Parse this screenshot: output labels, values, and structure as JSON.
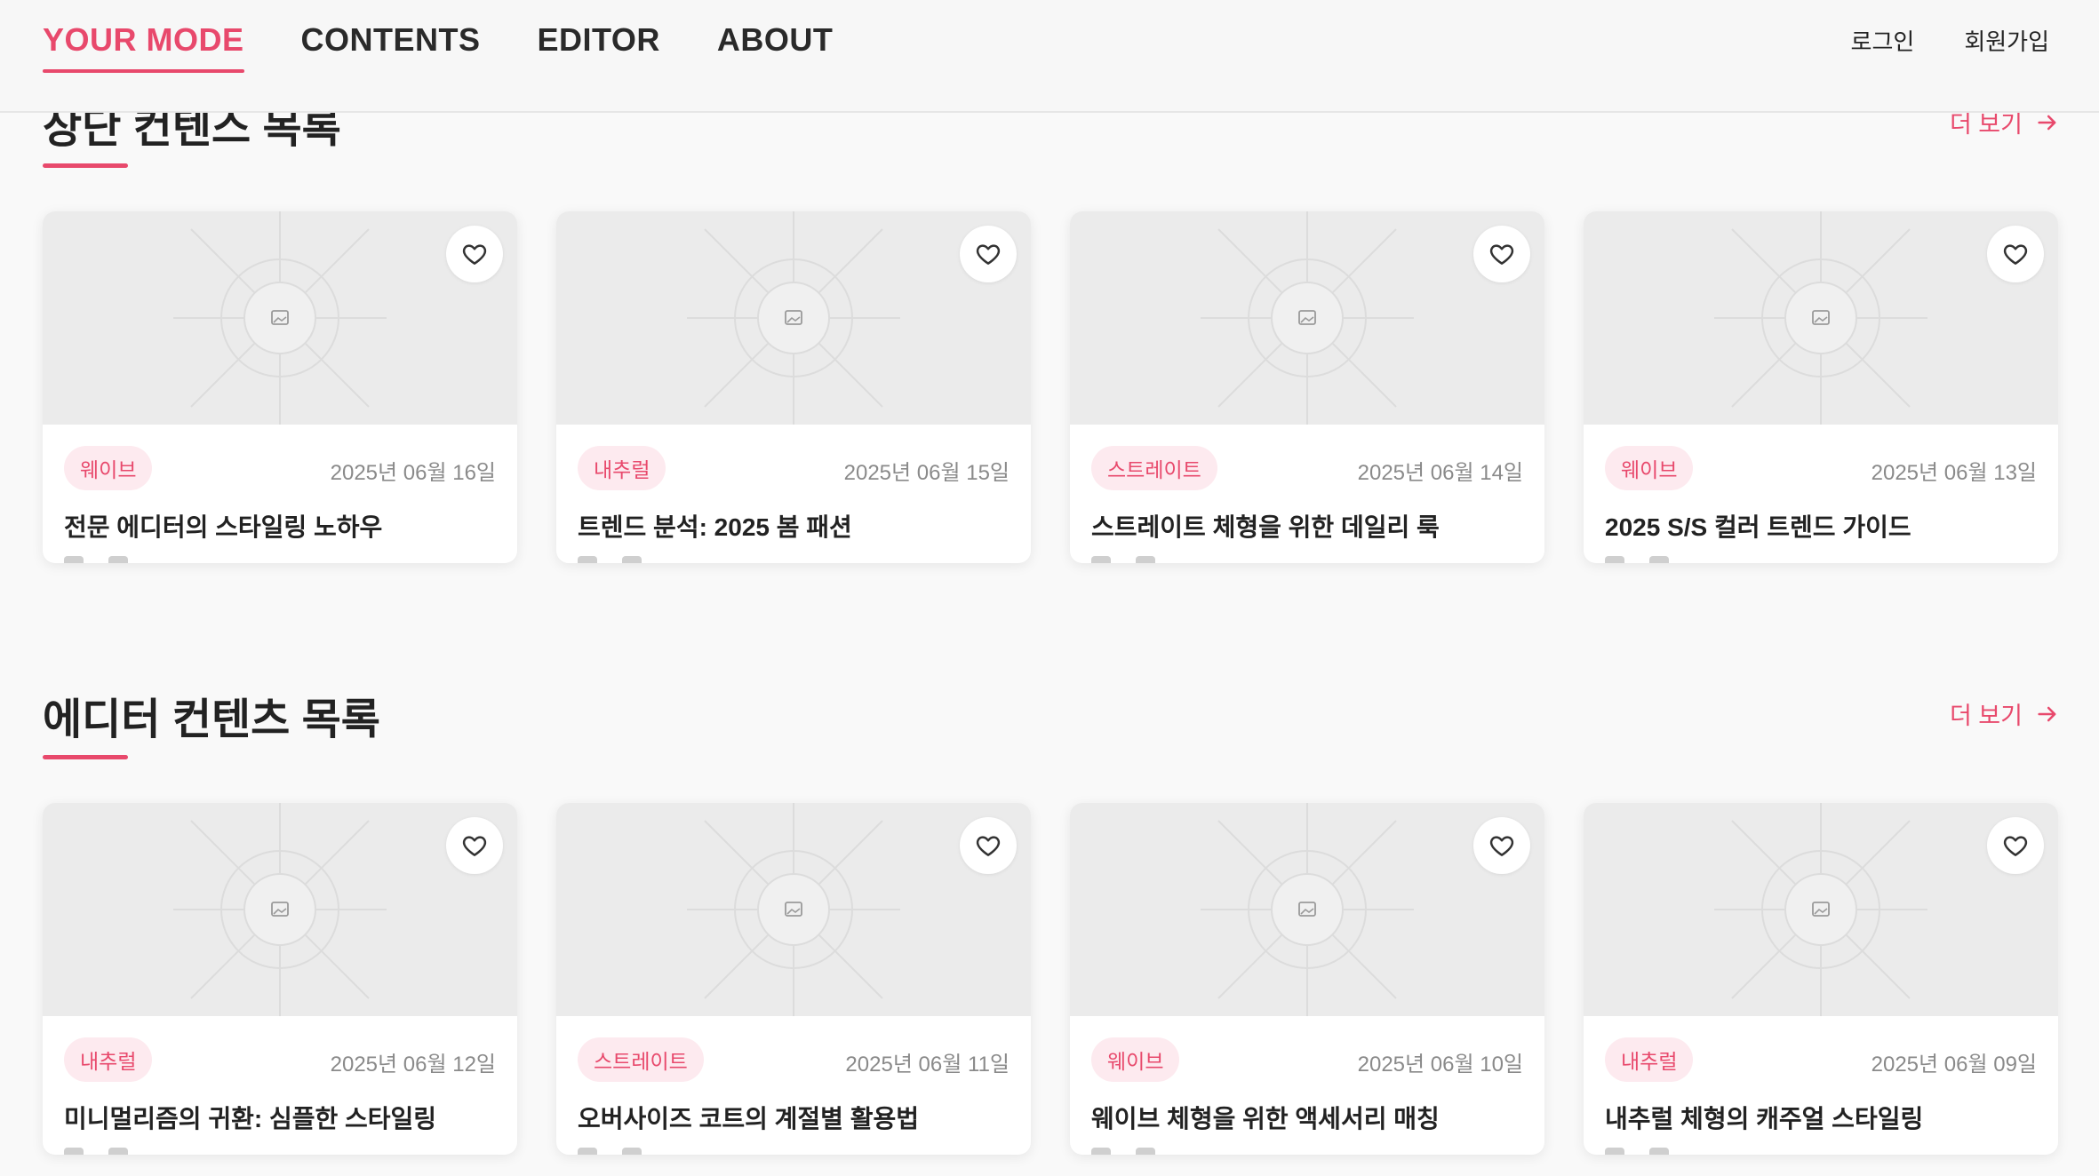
{
  "header": {
    "nav": [
      "YOUR MODE",
      "CONTENTS",
      "EDITOR",
      "ABOUT"
    ],
    "active_index": 0,
    "login": "로그인",
    "signup": "회원가입"
  },
  "colors": {
    "accent": "#e8496c",
    "tag_bg": "#fdeaef",
    "thumb_bg": "#ebebeb"
  },
  "sections": [
    {
      "title": "상단 컨텐스 목록",
      "more": "더 보기",
      "cards": [
        {
          "tag": "웨이브",
          "date": "2025년 06월 16일",
          "title": "전문 에디터의 스타일링 노하우"
        },
        {
          "tag": "내추럴",
          "date": "2025년 06월 15일",
          "title": "트렌드 분석: 2025 봄 패션"
        },
        {
          "tag": "스트레이트",
          "date": "2025년 06월 14일",
          "title": "스트레이트 체형을 위한 데일리 룩"
        },
        {
          "tag": "웨이브",
          "date": "2025년 06월 13일",
          "title": "2025 S/S 컬러 트렌드 가이드"
        }
      ]
    },
    {
      "title": "에디터 컨텐츠 목록",
      "more": "더 보기",
      "cards": [
        {
          "tag": "내추럴",
          "date": "2025년 06월 12일",
          "title": "미니멀리즘의 귀환: 심플한 스타일링"
        },
        {
          "tag": "스트레이트",
          "date": "2025년 06월 11일",
          "title": "오버사이즈 코트의 계절별 활용법"
        },
        {
          "tag": "웨이브",
          "date": "2025년 06월 10일",
          "title": "웨이브 체형을 위한 액세서리 매칭"
        },
        {
          "tag": "내추럴",
          "date": "2025년 06월 09일",
          "title": "내추럴 체형의 캐주얼 스타일링"
        }
      ]
    }
  ]
}
